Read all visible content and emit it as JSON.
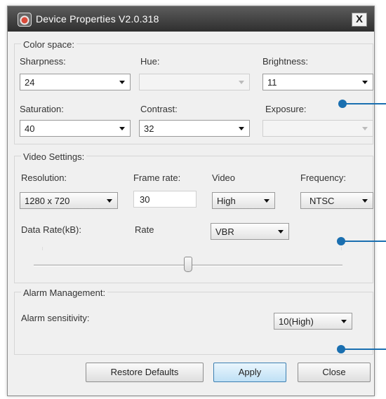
{
  "window": {
    "title": "Device Properties V2.0.318",
    "close_glyph": "X"
  },
  "color_space": {
    "group_label": "Color space:",
    "sharpness": {
      "label": "Sharpness:",
      "value": "24"
    },
    "hue": {
      "label": "Hue:",
      "value": ""
    },
    "brightness": {
      "label": "Brightness:",
      "value": "11"
    },
    "saturation": {
      "label": "Saturation:",
      "value": "40"
    },
    "contrast": {
      "label": "Contrast:",
      "value": "32"
    },
    "exposure": {
      "label": "Exposure:",
      "value": ""
    }
  },
  "video_settings": {
    "group_label": "Video Settings:",
    "resolution": {
      "label": "Resolution:",
      "value": "1280 x 720"
    },
    "frame_rate": {
      "label": "Frame rate:",
      "value": "30"
    },
    "video": {
      "label": "Video",
      "value": "High"
    },
    "frequency": {
      "label": "Frequency:",
      "value": "NTSC"
    },
    "data_rate": {
      "label": "Data Rate(kB):"
    },
    "rate": {
      "label": "Rate",
      "value": "VBR"
    },
    "slider_level": 0.5
  },
  "alarm": {
    "group_label": "Alarm Management:",
    "sensitivity": {
      "label": "Alarm sensitivity:",
      "value": "10(High)"
    }
  },
  "buttons": {
    "restore": "Restore Defaults",
    "apply": "Apply",
    "close": "Close"
  },
  "colors": {
    "callout": "#1a6fb0",
    "title_bar": "#3a3a3a"
  }
}
